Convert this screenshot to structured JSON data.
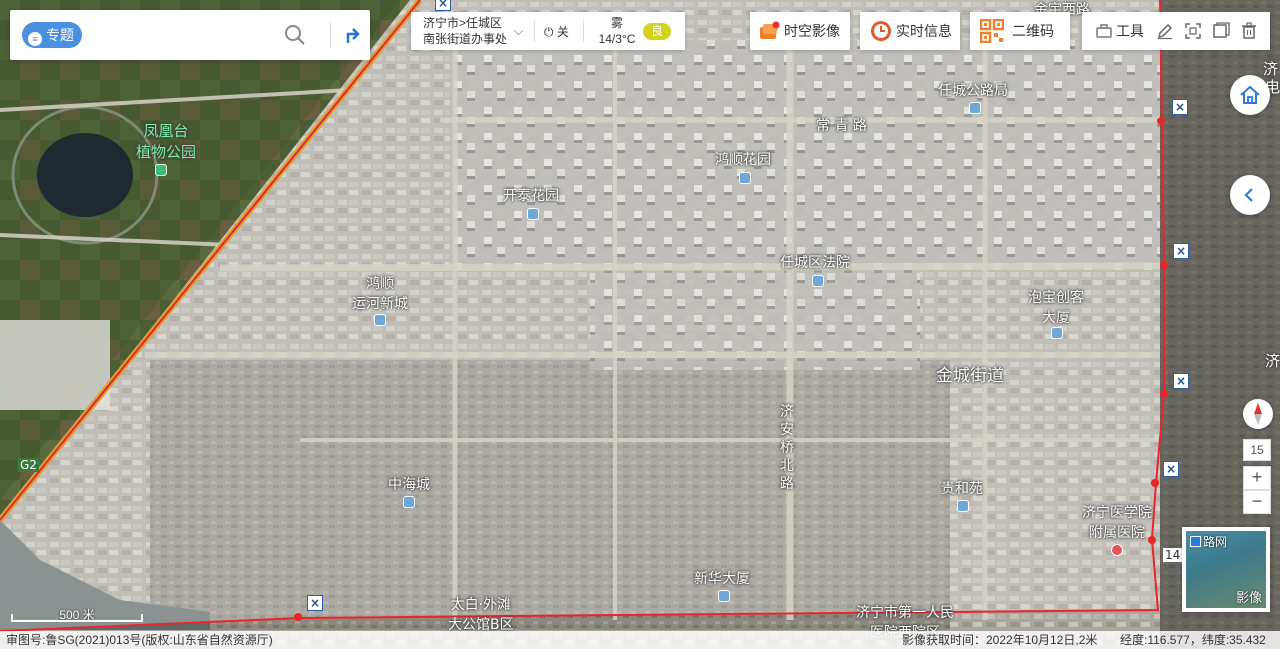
{
  "search": {
    "topic_label": "专题",
    "placeholder": ""
  },
  "location": {
    "path_line1": "济宁市>任城区",
    "path_line2": "南张街道办事处",
    "power_label": "关",
    "weather": "雾",
    "temperature": "14/3°C",
    "aqi": "良"
  },
  "top_buttons": {
    "timeline": "时空影像",
    "realtime": "实时信息",
    "qrcode": "二维码",
    "tools": "工具"
  },
  "controls": {
    "zoom_level": "15",
    "zoom_in": "+",
    "zoom_out": "−"
  },
  "minimap": {
    "roadnet_label": "路网",
    "imagery_label": "影像",
    "roadnet_checked": true
  },
  "scale_label": "500 米",
  "footer": {
    "approval": "审图号:鲁SG(2021)013号(版权:山东省自然资源厅)",
    "capture_time": "影像获取时间：2022年10月12日,2米",
    "coords": "经度:116.577，纬度:35.432"
  },
  "map_labels": {
    "park_line1": "凤凰台",
    "park_line2": "植物公园",
    "road_top": "金宇西路",
    "county_bureau": "任城公路局",
    "changqing": "常 青 路",
    "hongshun_garden": "鸿顺花园",
    "kaitai_garden": "开泰花园",
    "court": "任城区法院",
    "yunhe_line1": "鸿顺",
    "yunhe_line2": "运河新城",
    "paobao_line1": "泡宝创客",
    "paobao_line2": "大厦",
    "jincheng": "金城街道",
    "jian_road_1": "济",
    "jian_road_2": "安",
    "jian_road_3": "桥",
    "jian_road_4": "北",
    "jian_road_5": "路",
    "zhonghai": "中海城",
    "guihe": "贵和苑",
    "medcollege_line1": "济宁医学院",
    "medcollege_line2": "附属医院",
    "xinhua": "新华大厦",
    "taibai_line1": "太白·外滩",
    "taibai_line2": "大公馆B区",
    "hospital_bottom_line1": "济宁市第一人民",
    "hospital_bottom_line2": "医院西院区",
    "g_road": "G2",
    "badge_14": "14",
    "edge_ji_1": "济",
    "edge_ji_2": "济",
    "edge_dian": "电"
  },
  "colors": {
    "accent": "#4a90e2",
    "boundary": "#e8262a",
    "aqi": "#d4d31e"
  }
}
